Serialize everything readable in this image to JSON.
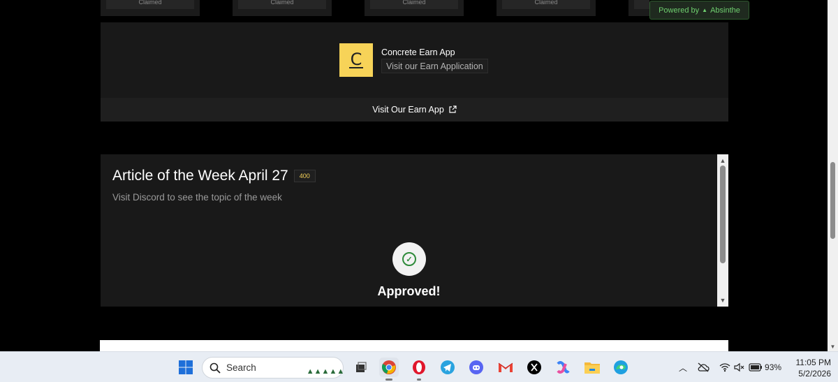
{
  "claim_cards": [
    {
      "label": "Claimed"
    },
    {
      "label": "Claimed"
    },
    {
      "label": "Claimed"
    },
    {
      "label": "Claimed"
    },
    {
      "label": "Claimed"
    }
  ],
  "powered_by": {
    "prefix": "Powered by",
    "brand": "Absinthe"
  },
  "earn_card": {
    "logo_letter": "C",
    "app_name": "Concrete Earn App",
    "app_description": "Visit our Earn Application",
    "footer_link": "Visit Our Earn App",
    "logo_color": "#f7d358"
  },
  "article_card": {
    "title": "Article of the Week April 27",
    "points_badge": "400",
    "subtitle": "Visit Discord to see the topic of the week",
    "status": "Approved!",
    "status_color": "#2e8b3a"
  },
  "taskbar": {
    "search_placeholder": "Search",
    "apps": [
      "start-icon",
      "search-icon",
      "task-view-icon",
      "chrome-icon",
      "opera-icon",
      "telegram-icon",
      "discord-icon",
      "gmail-icon",
      "x-icon",
      "copilot-icon",
      "file-explorer-icon",
      "edge-icon"
    ],
    "battery": "93%",
    "time": "11:05 PM",
    "date": "5/2/2026"
  }
}
